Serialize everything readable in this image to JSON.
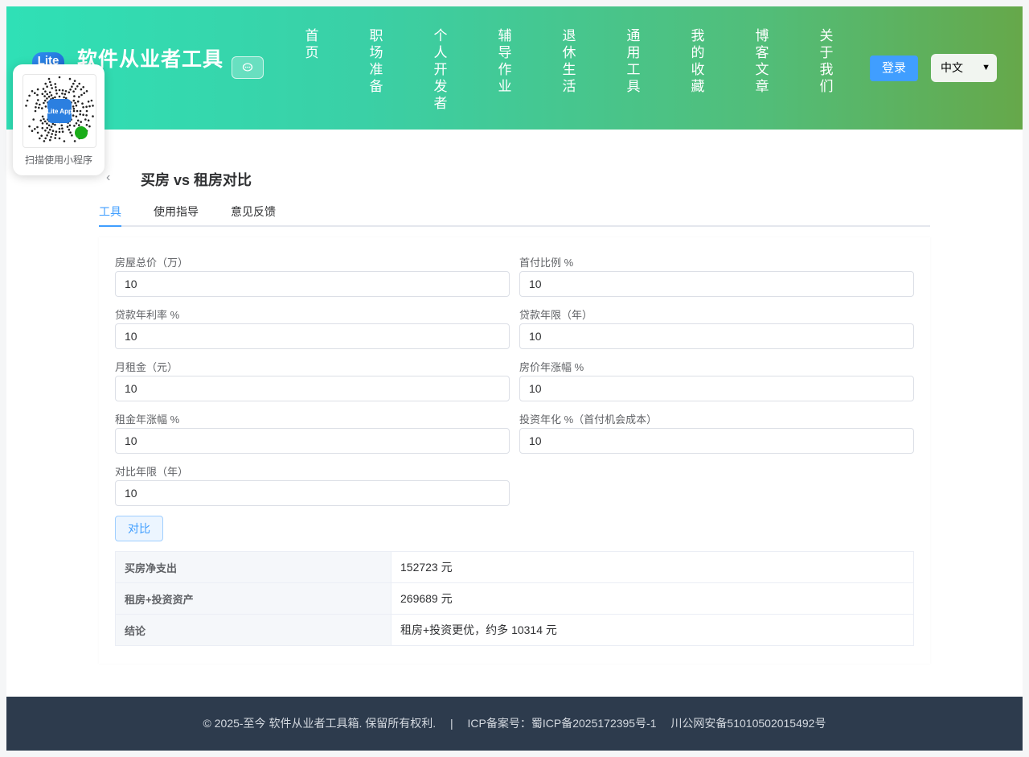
{
  "header": {
    "logo_text": "Lite",
    "site_title": "软件从业者工具",
    "nav": [
      "首页",
      "职场准备",
      "个人开发者",
      "辅导作业",
      "退休生活",
      "通用工具",
      "我的收藏",
      "博客文章",
      "关于我们"
    ],
    "login_label": "登录",
    "language": "中文"
  },
  "qr_popup": {
    "badge_text": "Lite App",
    "caption": "扫描使用小程序"
  },
  "main": {
    "title": "买房 vs 租房对比",
    "tabs": [
      "工具",
      "使用指导",
      "意见反馈"
    ],
    "active_tab": "工具",
    "fields": [
      {
        "label": "房屋总价（万）",
        "value": "10"
      },
      {
        "label": "首付比例 %",
        "value": "10"
      },
      {
        "label": "贷款年利率 %",
        "value": "10"
      },
      {
        "label": "贷款年限（年）",
        "value": "10"
      },
      {
        "label": "月租金（元）",
        "value": "10"
      },
      {
        "label": "房价年涨幅 %",
        "value": "10"
      },
      {
        "label": "租金年涨幅 %",
        "value": "10"
      },
      {
        "label": "投资年化 %（首付机会成本）",
        "value": "10"
      },
      {
        "label": "对比年限（年）",
        "value": "10"
      }
    ],
    "compare_label": "对比",
    "results": [
      {
        "key": "买房净支出",
        "value": "152723 元"
      },
      {
        "key": "租房+投资资产",
        "value": "269689 元"
      },
      {
        "key": "结论",
        "value": "租房+投资更优，约多 10314 元"
      }
    ]
  },
  "footer": {
    "copyright": "© 2025-至今 软件从业者工具箱. 保留所有权利.",
    "separator": "|",
    "icp": "ICP备案号：蜀ICP备2025172395号-1",
    "police": "川公网安备51010502015492号"
  },
  "colors": {
    "accent": "#409eff",
    "footer_bg": "#2d3b4d"
  }
}
